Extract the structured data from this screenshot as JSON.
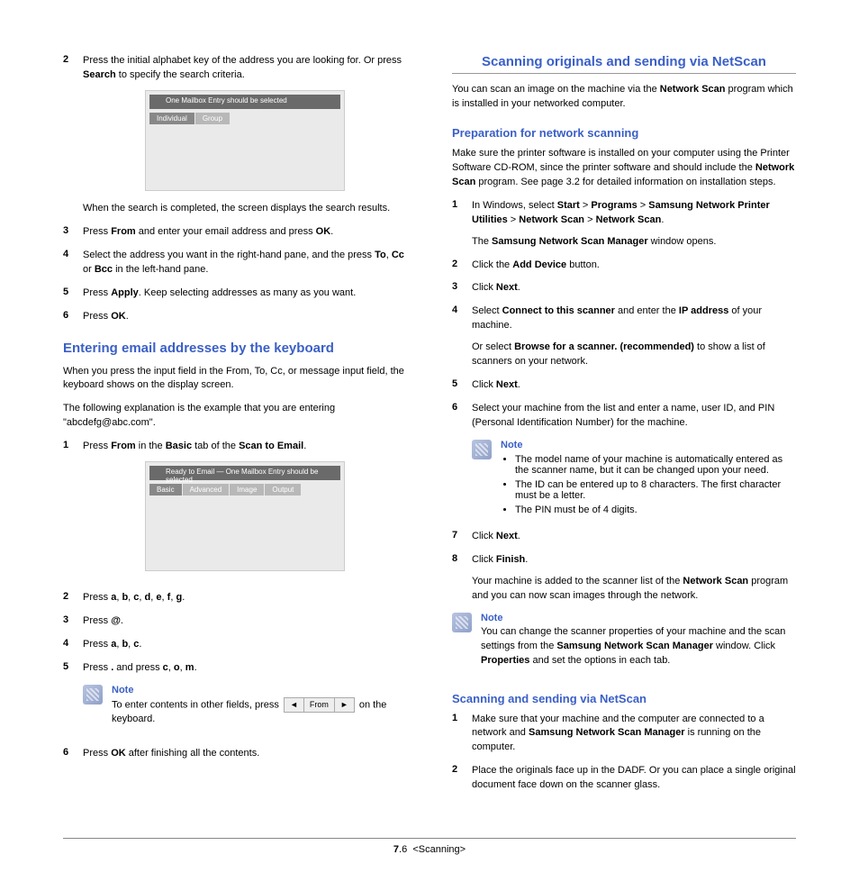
{
  "left": {
    "step2": {
      "p1a": "Press the initial alphabet key of the address you are looking for. Or press ",
      "p1b": "Search",
      "p1c": " to specify the search criteria.",
      "p2": "When the search is completed, the screen displays the search results."
    },
    "step3": {
      "a": "Press ",
      "b": "From",
      "c": " and enter your email address and press ",
      "d": "OK",
      "e": "."
    },
    "step4": {
      "a": "Select the address you want in the right-hand pane, and the press ",
      "b": "To",
      "c": ", ",
      "d": "Cc",
      "e": " or ",
      "f": "Bcc",
      "g": " in the left-hand pane."
    },
    "step5": {
      "a": "Press ",
      "b": "Apply",
      "c": ". Keep selecting addresses as many as you want."
    },
    "step6": {
      "a": "Press ",
      "b": "OK",
      "c": "."
    },
    "h2a": "Entering email addresses by the keyboard",
    "intro1": "When you press the input field in the From, To, Cc, or message input field, the keyboard shows on the display screen.",
    "intro2": "The following explanation is the example that you are entering \"abcdefg@abc.com\".",
    "kstep1": {
      "a": "Press ",
      "b": "From",
      "c": " in the ",
      "d": "Basic",
      "e": " tab of the ",
      "f": "Scan to Email",
      "g": "."
    },
    "kstep2": {
      "a": "Press ",
      "b1": "a",
      "c": ", ",
      "b2": "b",
      "b3": "c",
      "b4": "d",
      "b5": "e",
      "b6": "f",
      "b7": "g",
      "end": "."
    },
    "kstep3": {
      "a": "Press ",
      "b": "@",
      "c": "."
    },
    "kstep4": {
      "a": "Press ",
      "b1": "a",
      "c": ", ",
      "b2": "b",
      "b3": "c",
      "end": "."
    },
    "kstep5": {
      "a": "Press ",
      "b": ".",
      "c": " and press ",
      "d1": "c",
      "d2": "o",
      "d3": "m",
      "end": "."
    },
    "note1": {
      "title": "Note",
      "text_a": "To enter contents in other fields, press ",
      "text_b": " on the keyboard.",
      "widget": {
        "l": "◄",
        "mid": "From",
        "r": "►"
      }
    },
    "kstep6": {
      "a": "Press ",
      "b": "OK",
      "c": " after finishing all the contents."
    }
  },
  "right": {
    "section_title": "Scanning originals and sending via NetScan",
    "intro": {
      "a": "You can scan an image on the machine via the ",
      "b": "Network Scan",
      "c": " program which is installed in your networked computer."
    },
    "h3a": "Preparation for network scanning",
    "prep_intro": {
      "a": "Make sure the printer software is installed on your computer using the Printer Software CD-ROM, since the printer software and should include the ",
      "b": "Network Scan",
      "c": " program. See page 3.2 for detailed information on installation steps."
    },
    "pstep1": {
      "a": "In Windows, select ",
      "b1": "Start",
      "gt": " > ",
      "b2": "Programs",
      "b3": "Samsung Network Printer Utilities",
      "b4": "Network Scan",
      "b5": "Network Scan",
      "end": ".",
      "p2a": "The ",
      "p2b": "Samsung Network Scan Manager",
      "p2c": " window opens."
    },
    "pstep2": {
      "a": "Click the ",
      "b": "Add Device",
      "c": " button."
    },
    "pstep3": {
      "a": "Click ",
      "b": "Next",
      "c": "."
    },
    "pstep4": {
      "a": "Select ",
      "b": "Connect to this scanner",
      "c": " and enter the ",
      "d": "IP address",
      "e": " of your machine.",
      "p2a": "Or select ",
      "p2b": "Browse for a scanner. (recommended)",
      "p2c": " to show a list of scanners on your network."
    },
    "pstep5": {
      "a": "Click ",
      "b": "Next",
      "c": "."
    },
    "pstep6": {
      "a": "Select your machine from the list and enter a name, user ID, and PIN (Personal Identification Number) for the machine."
    },
    "note2": {
      "title": "Note",
      "li1": "The model name of your machine is automatically entered as the scanner name, but it can be changed upon your need.",
      "li2": "The ID can be entered up to 8 characters. The first character must be a letter.",
      "li3": "The PIN must be of 4 digits."
    },
    "pstep7": {
      "a": "Click ",
      "b": "Next",
      "c": "."
    },
    "pstep8": {
      "a": "Click ",
      "b": "Finish",
      "c": ".",
      "p2a": "Your machine is added to the scanner list of the ",
      "p2b": "Network Scan",
      "p2c": " program and you can now scan images through the network."
    },
    "note3": {
      "title": "Note",
      "a": "You can change the scanner properties of your machine and the scan settings from the ",
      "b": "Samsung Network Scan Manager",
      "c": " window. Click ",
      "d": "Properties",
      "e": " and set the options in each tab."
    },
    "h3b": "Scanning and sending via NetScan",
    "sstep1": {
      "a": "Make sure that your machine and the computer are connected to a network and ",
      "b": "Samsung Network Scan Manager",
      "c": " is running on the computer."
    },
    "sstep2": {
      "a": "Place the originals face up in the DADF. Or you can place a single original document face down on the scanner glass."
    }
  },
  "footer": {
    "page_bold": "7",
    "page_rest": ".6",
    "label": "<Scanning>"
  }
}
